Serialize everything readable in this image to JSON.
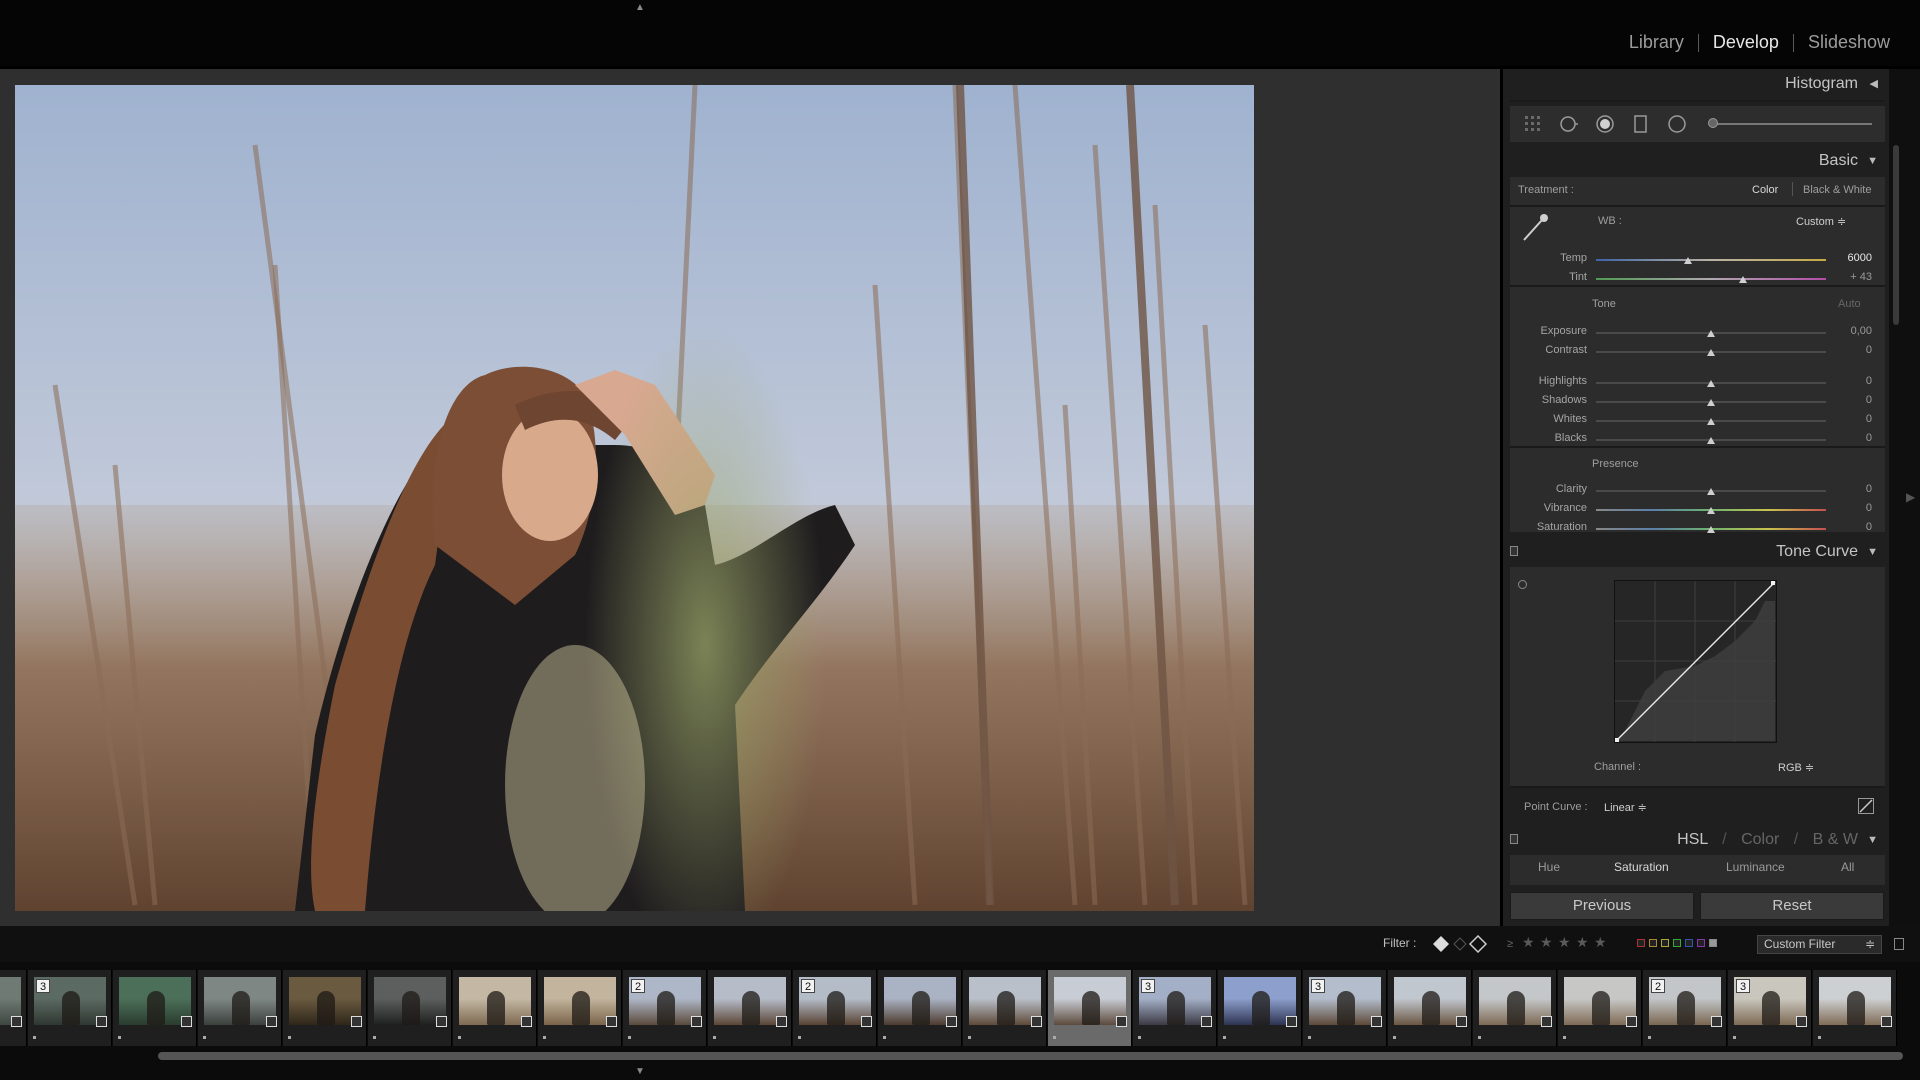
{
  "modules": [
    "Library",
    "Develop",
    "Slideshow"
  ],
  "active_module": "Develop",
  "panels": {
    "histogram": "Histogram",
    "basic": "Basic",
    "tone_curve": "Tone Curve",
    "hsl": {
      "hsl": "HSL",
      "color": "Color",
      "bw": "B & W",
      "sep": "/"
    }
  },
  "basic": {
    "treatment_label": "Treatment :",
    "treatment_color": "Color",
    "treatment_bw": "Black & White",
    "wb_label": "WB :",
    "wb_value": "Custom ≑",
    "tone_label": "Tone",
    "auto_label": "Auto",
    "presence_label": "Presence",
    "sliders": [
      {
        "label": "Temp",
        "value": "6000",
        "pos": 0.4
      },
      {
        "label": "Tint",
        "value": "+ 43",
        "pos": 0.64
      },
      {
        "label": "Exposure",
        "value": "0,00",
        "pos": 0.5
      },
      {
        "label": "Contrast",
        "value": "0",
        "pos": 0.5
      },
      {
        "label": "Highlights",
        "value": "0",
        "pos": 0.5
      },
      {
        "label": "Shadows",
        "value": "0",
        "pos": 0.5
      },
      {
        "label": "Whites",
        "value": "0",
        "pos": 0.5
      },
      {
        "label": "Blacks",
        "value": "0",
        "pos": 0.5
      },
      {
        "label": "Clarity",
        "value": "0",
        "pos": 0.5
      },
      {
        "label": "Vibrance",
        "value": "0",
        "pos": 0.5
      },
      {
        "label": "Saturation",
        "value": "0",
        "pos": 0.5
      }
    ]
  },
  "tone_curve": {
    "channel_label": "Channel :",
    "channel_value": "RGB ≑",
    "point_curve_label": "Point Curve :",
    "point_curve_value": "Linear ≑"
  },
  "hsl_tabs": [
    "Hue",
    "Saturation",
    "Luminance",
    "All"
  ],
  "hsl_active": "Saturation",
  "buttons": {
    "previous": "Previous",
    "reset": "Reset"
  },
  "filter": {
    "label": "Filter :",
    "ge": "≥",
    "custom_filter": "Custom Filter",
    "custom_filter_arrow": "≑"
  },
  "filmstrip": {
    "badges": [
      "",
      "3",
      "",
      "",
      "",
      "",
      "",
      "",
      "2",
      "",
      "2",
      "",
      "",
      "",
      "3",
      "",
      "3",
      "",
      "",
      "",
      "2",
      "3",
      ""
    ],
    "selected_index": 13
  },
  "colors": {
    "accent": "#e6e6e6",
    "panel": "#2c2c2c",
    "background": "#2f2f2f"
  }
}
